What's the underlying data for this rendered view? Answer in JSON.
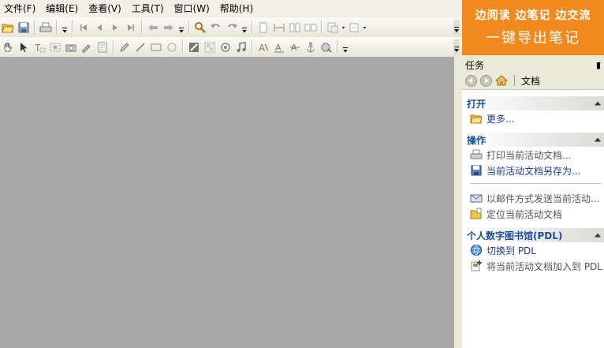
{
  "menu": [
    "文件(F)",
    "编辑(E)",
    "查看(V)",
    "工具(T)",
    "窗口(W)",
    "帮助(H)"
  ],
  "banner": {
    "line1": "边阅读  边笔记  边交流",
    "line2": "一键导出笔记",
    "color": "#f08a1e"
  },
  "taskpane": {
    "title": "任务",
    "pin": "▮",
    "context": "文档",
    "sections": {
      "open": {
        "title": "打开",
        "items": [
          "更多..."
        ]
      },
      "ops": {
        "title": "操作",
        "items": [
          "打印当前活动文档...",
          "当前活动文档另存为...",
          "以邮件方式发送当前活动...",
          "定位当前活动文档"
        ]
      },
      "pdl": {
        "title": "个人数字图书馆(PDL)",
        "items": [
          "切换到 PDL",
          "将当前活动文档加入到 PDL"
        ]
      }
    }
  },
  "colors": {
    "workspace": "#a9a9a9",
    "chrome": "#ece9d8",
    "section_title": "#1a5099",
    "link": "#1e3c8c"
  }
}
